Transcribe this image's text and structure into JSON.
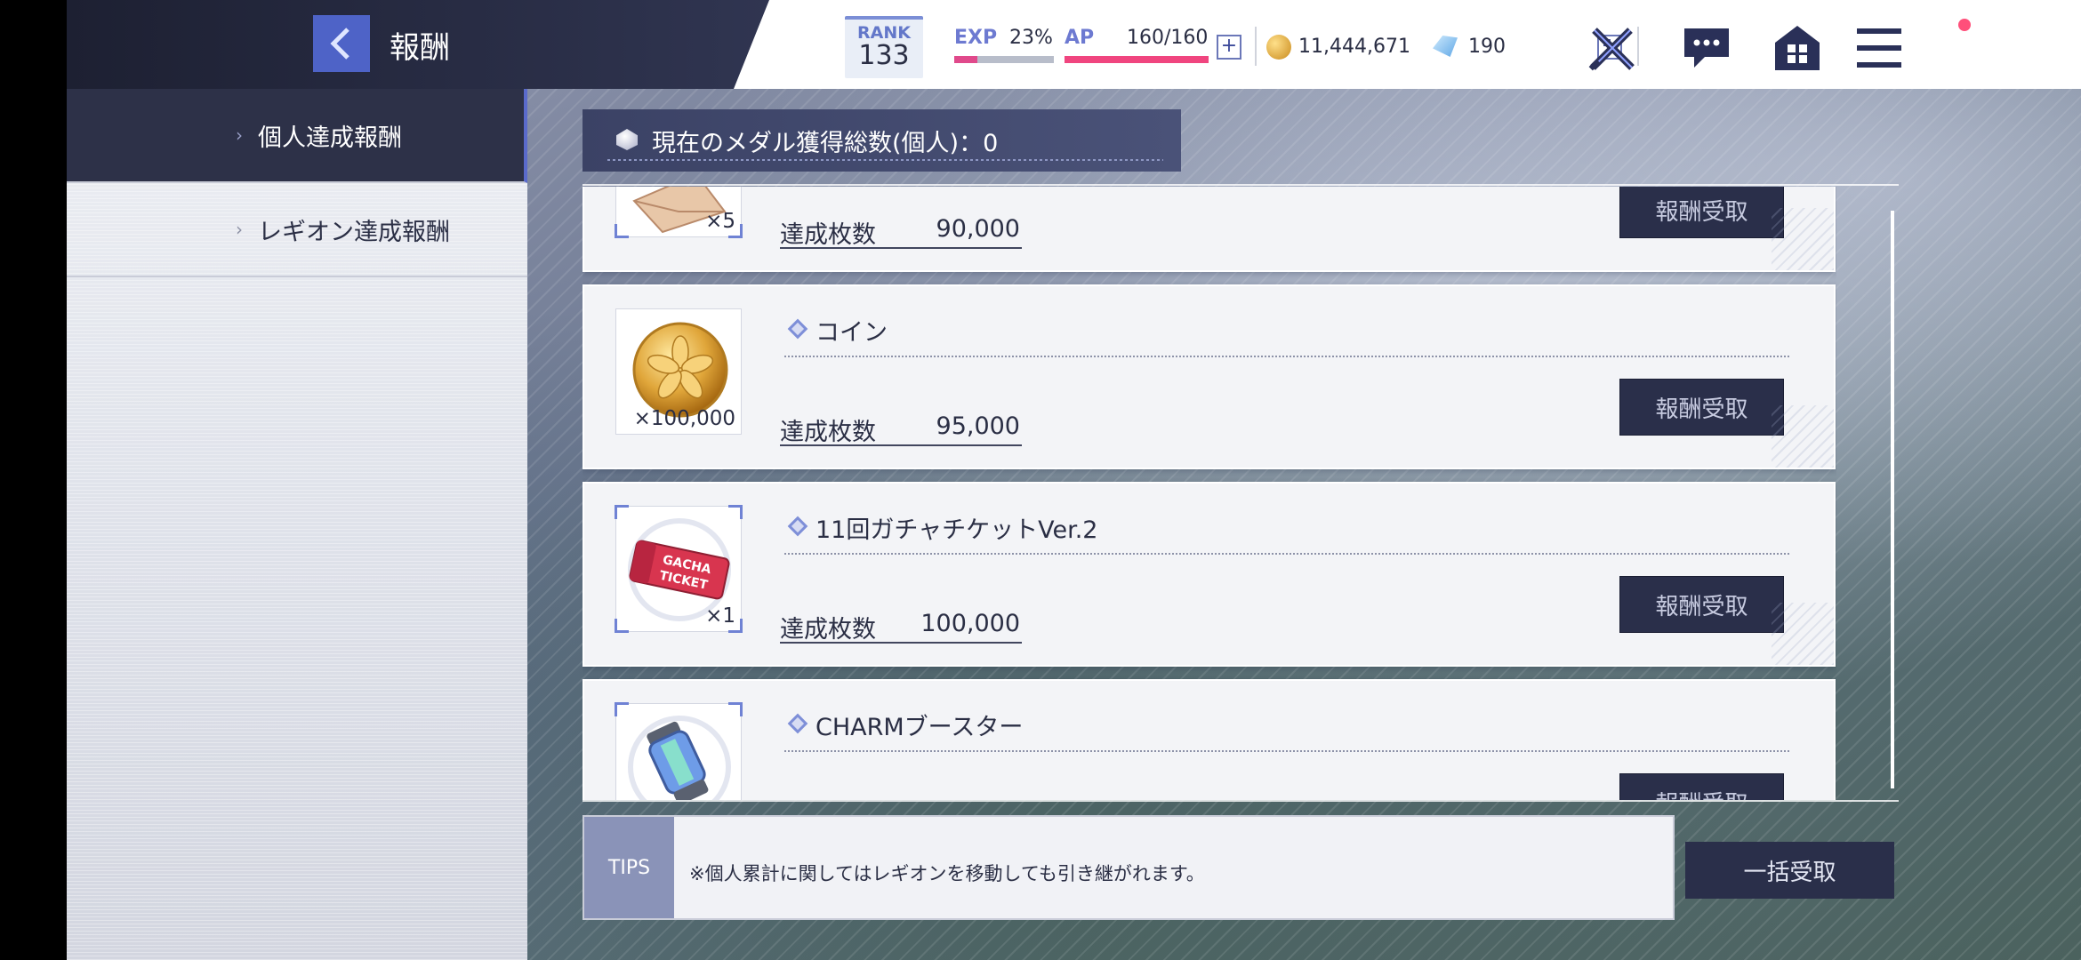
{
  "header": {
    "title": "報酬",
    "rank_label": "RANK",
    "rank_value": "133",
    "exp_label": "EXP",
    "exp_percent": "23%",
    "exp_fraction": 0.23,
    "ap_label": "AP",
    "ap_value": "160/160",
    "ap_fraction": 1.0,
    "plus": "+",
    "coins": "11,444,671",
    "gems": "190"
  },
  "sidebar": {
    "items": [
      {
        "label": "個人達成報酬",
        "active": true
      },
      {
        "label": "レギオン達成報酬",
        "active": false
      }
    ]
  },
  "banner": {
    "text": "現在のメダル獲得総数(個人)：0"
  },
  "rewards": [
    {
      "name": "",
      "qty": "×5",
      "req_label": "達成枚数",
      "req_value": "90,000",
      "button": "報酬受取",
      "icon": "envelope-icon"
    },
    {
      "name": "コイン",
      "qty": "×100,000",
      "req_label": "達成枚数",
      "req_value": "95,000",
      "button": "報酬受取",
      "icon": "coin-icon"
    },
    {
      "name": "11回ガチャチケットVer.2",
      "qty": "×1",
      "req_label": "達成枚数",
      "req_value": "100,000",
      "button": "報酬受取",
      "icon": "gacha-ticket-icon",
      "ticket_text": [
        "GACHA",
        "TICKET"
      ]
    },
    {
      "name": "CHARMブースター",
      "qty": "",
      "req_label": "",
      "req_value": "",
      "button": "報酬受取",
      "icon": "charm-booster-icon"
    }
  ],
  "tips": {
    "label": "TIPS",
    "text": "※個人累計に関してはレギオンを移動しても引き継がれます。"
  },
  "bulk_button": "一括受取",
  "colors": {
    "accent": "#4e63c7",
    "dark_button": "#2a2f4a",
    "sidebar_active": "#2d3148",
    "ap_bar": "#f0457f"
  }
}
